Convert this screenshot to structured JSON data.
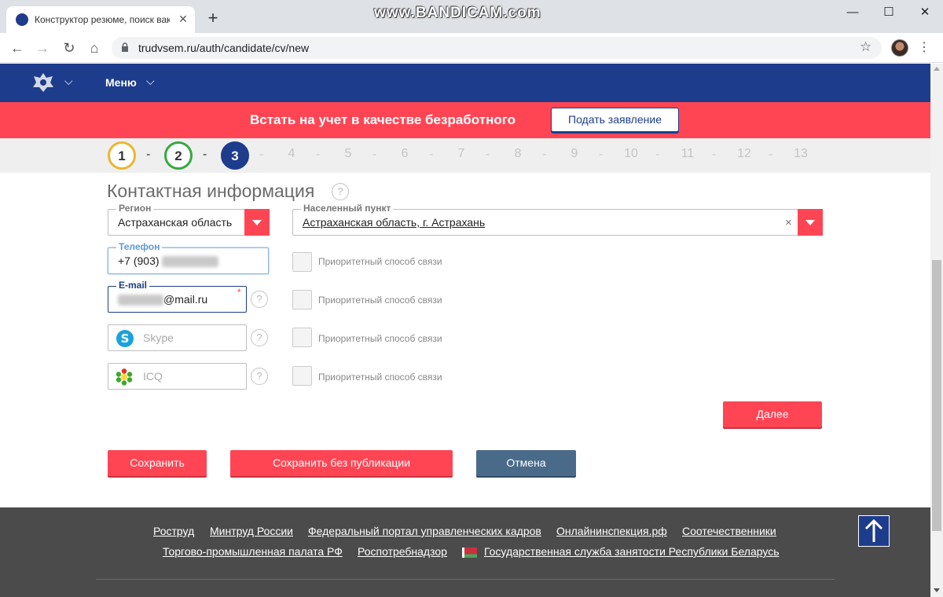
{
  "browser": {
    "tab_title": "Конструктор резюме, поиск вак",
    "url": "trudvsem.ru/auth/candidate/cv/new",
    "watermark": "www.BANDICAM.com"
  },
  "site": {
    "menu_label": "Меню",
    "banner_text": "Встать на учет в качестве безработного",
    "banner_button": "Подать заявление",
    "brand_color": "#1e3c8c",
    "accent_color": "#ff4554"
  },
  "steps": {
    "items": [
      "1",
      "2",
      "3",
      "4",
      "5",
      "6",
      "7",
      "8",
      "9",
      "10",
      "11",
      "12",
      "13"
    ],
    "current": 3,
    "separator": "-"
  },
  "form": {
    "section_title": "Контактная информация",
    "help_glyph": "?",
    "region": {
      "label": "Регион",
      "value": "Астраханская область"
    },
    "city": {
      "label": "Населенный пункт",
      "value": "Астраханская область, г. Астрахань",
      "clear_glyph": "×"
    },
    "phone": {
      "label": "Телефон",
      "value_prefix": "+7 (903)"
    },
    "email": {
      "label": "E-mail",
      "value_suffix": "@mail.ru",
      "required_mark": "*"
    },
    "skype": {
      "placeholder": "Skype"
    },
    "icq": {
      "placeholder": "ICQ"
    },
    "priority_label": "Приоритетный способ связи",
    "next_button": "Далее",
    "save_button": "Сохранить",
    "save_unpublished_button": "Сохранить без публикации",
    "cancel_button": "Отмена"
  },
  "footer": {
    "row1": [
      "Роструд",
      "Минтруд России",
      "Федеральный портал управленческих кадров",
      "Онлайнинспекция.рф",
      "Соотечественники"
    ],
    "row2": [
      "Торгово-промышленная палата РФ",
      "Роспотребнадзор",
      "Государственная служба занятости Республики Беларусь"
    ]
  }
}
